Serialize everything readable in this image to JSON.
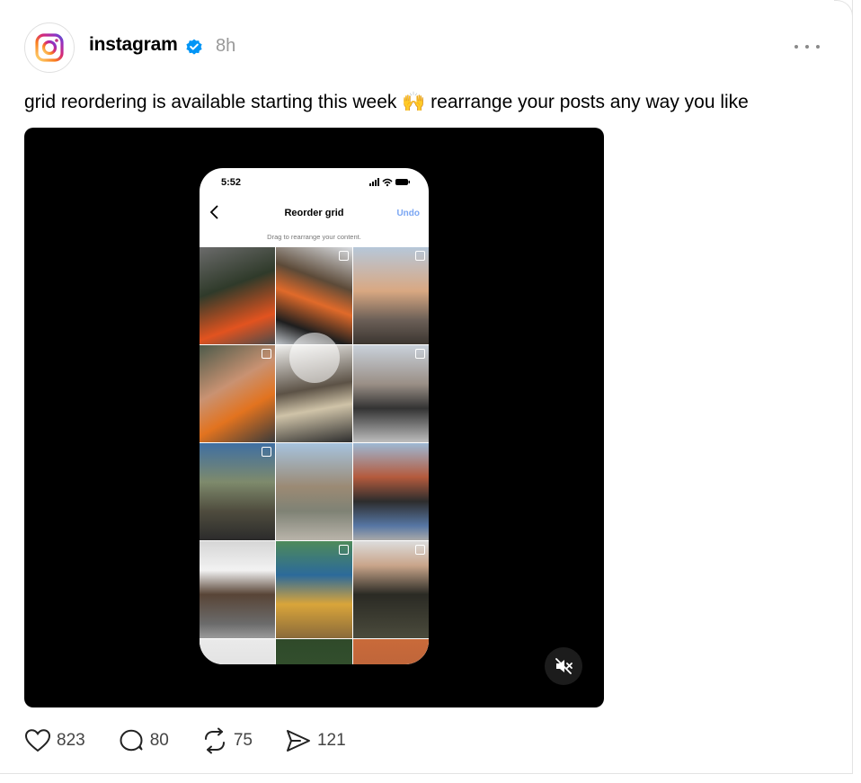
{
  "post": {
    "username": "instagram",
    "time": "8h",
    "caption": "grid reordering is available starting this week 🙌 rearrange your posts any way you like",
    "colors": {
      "verified": "#0095f6",
      "muted_text": "#999999"
    }
  },
  "video": {
    "phone": {
      "clock": "5:52",
      "title": "Reorder grid",
      "undo_label": "Undo",
      "hint": "Drag to rearrange your content."
    }
  },
  "actions": {
    "likes": "823",
    "replies": "80",
    "reposts": "75",
    "shares": "121"
  },
  "icons": [
    "instagram-logo-icon",
    "verified-icon",
    "more-icon",
    "back-icon",
    "mute-icon",
    "heart-icon",
    "comment-icon",
    "repost-icon",
    "share-icon"
  ]
}
